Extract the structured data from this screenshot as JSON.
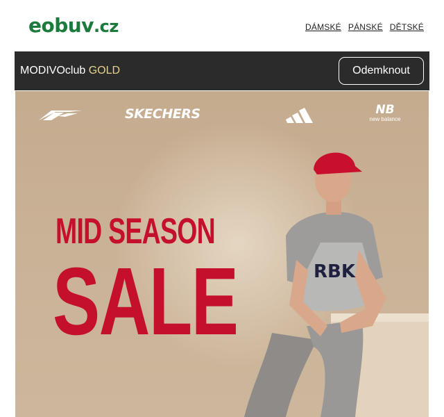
{
  "header": {
    "logo_main": "eobuv",
    "logo_tld": ".cz",
    "nav": [
      {
        "label": "DÁMSKÉ"
      },
      {
        "label": "PÁNSKÉ"
      },
      {
        "label": "DĚTSKÉ"
      }
    ]
  },
  "club_bar": {
    "label_prefix": "MODIVOclub",
    "label_highlight": "GOLD",
    "button_label": "Odemknout",
    "highlight_color": "#e7d28c"
  },
  "banner": {
    "brands": [
      {
        "name": "Reebok",
        "icon": "reebok-logo"
      },
      {
        "name": "SKECHERS",
        "icon": "skechers-logo"
      },
      {
        "name": "adidas",
        "icon": "adidas-logo"
      },
      {
        "name": "new balance",
        "icon": "new-balance-logo"
      }
    ],
    "headline_1": "MID SEASON",
    "headline_2": "SALE",
    "headline_color": "#c4102d",
    "shirt_print": "RBK"
  }
}
